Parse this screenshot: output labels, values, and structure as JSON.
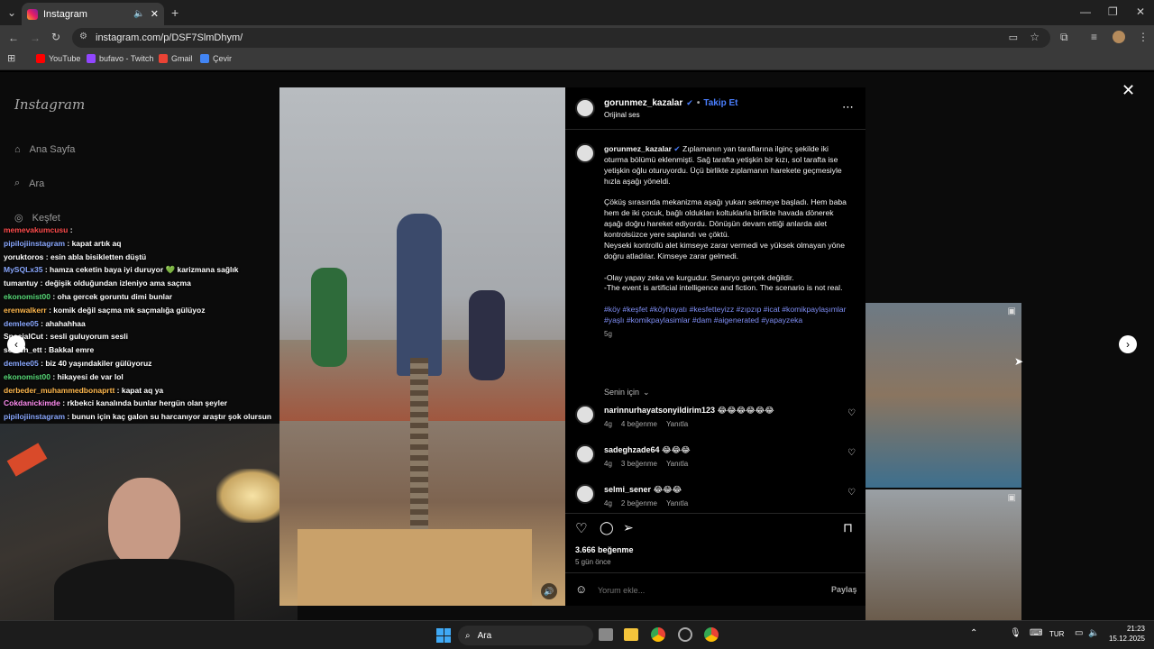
{
  "browser": {
    "tab_title": "Instagram",
    "url": "instagram.com/p/DSF7SlmDhym/",
    "bookmarks": [
      "YouTube",
      "bufavo - Twitch",
      "Gmail",
      "Çevir"
    ]
  },
  "sidebar": {
    "logo": "Instagram",
    "items": [
      "Ana Sayfa",
      "Ara",
      "Keşfet"
    ]
  },
  "chat": [
    {
      "user": "memevakumcusu",
      "color": "#ff4c4c",
      "msg": ""
    },
    {
      "user": "pipilojiinstagram",
      "color": "#8aa8ff",
      "msg": "kapat artık aq"
    },
    {
      "user": "yoruktoros",
      "color": "#ffffff",
      "msg": "esin abla bisikletten düştü"
    },
    {
      "user": "MySQLx35",
      "color": "#8aa8ff",
      "msg": "hamza ceketin baya iyi duruyor 💚 karizmana sağlık"
    },
    {
      "user": "tumantuy",
      "color": "#ffffff",
      "msg": "değişik olduğundan izleniyo ama saçma"
    },
    {
      "user": "ekonomist00",
      "color": "#57d977",
      "msg": "oha gercek goruntu dimi bunlar"
    },
    {
      "user": "erenwalkerr",
      "color": "#ffb84d",
      "msg": "komik değil saçma mk saçmalığa gülüyoz"
    },
    {
      "user": "demlee05",
      "color": "#8aa8ff",
      "msg": "ahahahhaa"
    },
    {
      "user": "SpecialCut",
      "color": "#ffffff",
      "msg": "sesli guluyorum sesli"
    },
    {
      "user": "search_ett",
      "color": "#ffffff",
      "msg": "Bakkal emre"
    },
    {
      "user": "demlee05",
      "color": "#8aa8ff",
      "msg": "biz 40 yaşındakiler gülüyoruz"
    },
    {
      "user": "ekonomist00",
      "color": "#57d977",
      "msg": "hikayesi de var lol"
    },
    {
      "user": "derbeder_muhammedbonaprtt",
      "color": "#ffb84d",
      "msg": "kapat aq ya"
    },
    {
      "user": "Cokdanickimde",
      "color": "#ff8cf0",
      "msg": "rkbekci kanalında bunlar hergün olan şeyler"
    },
    {
      "user": "pipilojiinstagram",
      "color": "#8aa8ff",
      "msg": "bunun için kaç galon su harcanıyor araştır şok olursun"
    }
  ],
  "post": {
    "username": "gorunmez_kazalar",
    "follow": "Takip Et",
    "audio": "Orijinal ses",
    "caption_p1": "Zıplamanın yan taraflarına ilginç şekilde iki oturma bölümü eklenmişti. Sağ tarafta yetişkin bir kızı, sol tarafta ise yetişkin oğlu oturuyordu. Üçü birlikte zıplamanın harekete geçmesiyle hızla aşağı yöneldi.",
    "caption_p2": "Çöküş sırasında mekanizma aşağı yukarı sekmeye başladı. Hem baba hem de iki çocuk, bağlı oldukları koltuklarla birlikte havada dönerek aşağı doğru hareket ediyordu. Dönüşün devam ettiği anlarda alet kontrolsüzce yere saplandı ve çöktü.",
    "caption_p3": "Neyseki kontrollü alet kimseye zarar vermedi ve yüksek olmayan yöne doğru atladılar. Kimseye zarar gelmedi.",
    "caption_p4": "-Olay yapay zeka ve kurgudur. Senaryo gerçek değildir.",
    "caption_p5": "-The event is artificial intelligence and fiction. The scenario is not real.",
    "hashtags": "#köy #keşfet #köyhayatı #kesfetteyizz #zıpzıp #icat #komikpaylaşımlar #yaşlı #komikpaylasimlar #dam #aigenerated #yapayzeka",
    "caption_age": "5g",
    "for_you": "Senin için",
    "likes": "3.666 beğenme",
    "posted": "5 gün önce",
    "comment_placeholder": "Yorum ekle...",
    "share": "Paylaş"
  },
  "comments": [
    {
      "user": "narinnurhayatsonyildirim123",
      "text": "😂😂😂😂😂😂",
      "age": "4g",
      "likes": "4 beğenme",
      "reply": "Yanıtla"
    },
    {
      "user": "sadeghzade64",
      "text": "😂😂😂",
      "age": "4g",
      "likes": "3 beğenme",
      "reply": "Yanıtla"
    },
    {
      "user": "selmi_sener",
      "text": "😂😂😂",
      "age": "4g",
      "likes": "2 beğenme",
      "reply": "Yanıtla"
    }
  ],
  "taskbar": {
    "search": "Ara",
    "lang": "TUR",
    "time": "21:23",
    "date": "15.12.2025"
  },
  "colors": {
    "accent": "#4a7fff",
    "link": "#7f8ef5",
    "bg": "#0b0b0b"
  }
}
